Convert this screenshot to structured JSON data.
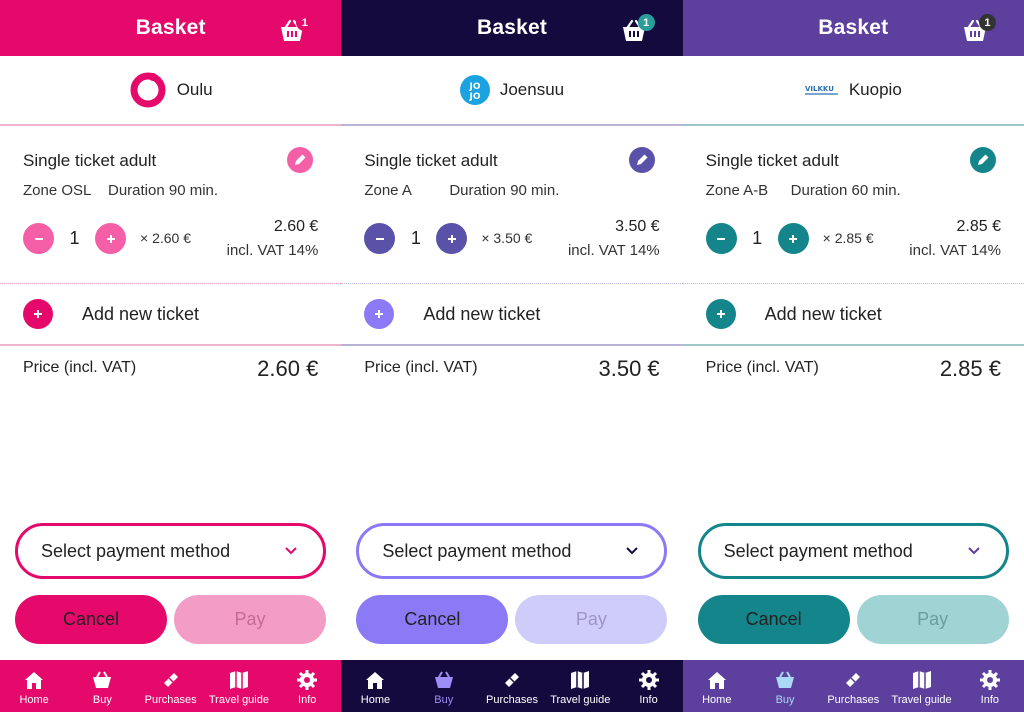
{
  "panels": [
    {
      "city": "Oulu",
      "logo": "oulu-logo",
      "header": {
        "title": "Basket",
        "basket_count": "1"
      },
      "ticket": {
        "name": "Single ticket adult",
        "zone": "Zone OSL",
        "duration": "Duration 90 min.",
        "quantity": "1",
        "unit_price": "× 2.60 €",
        "line_price": "2.60 €",
        "vat": "incl. VAT 14%"
      },
      "add_ticket": "Add new ticket",
      "price_label": "Price  (incl. VAT)",
      "price_value": "2.60 €",
      "payment_select": "Select payment method",
      "cancel": "Cancel",
      "pay": "Pay",
      "tabs": [
        "Home",
        "Buy",
        "Purchases",
        "Travel guide",
        "Info"
      ],
      "colors": {
        "header": "#e5096b",
        "accent": "#f45fa7",
        "add": "#e5096b",
        "cancel_bg": "#e5096b",
        "pay_bg": "#f39dc6",
        "pay_text": "#c46a95",
        "tabbar": "#e5096b",
        "divider": "#f1b4cf",
        "active_tab": "#ffffff",
        "badge": "#e5096b",
        "logo": "#e5096b"
      }
    },
    {
      "city": "Joensuu",
      "logo": "jojo-logo",
      "header": {
        "title": "Basket",
        "basket_count": "1"
      },
      "ticket": {
        "name": "Single ticket adult",
        "zone": "Zone A",
        "duration": "Duration 90 min.",
        "quantity": "1",
        "unit_price": "× 3.50 €",
        "line_price": "3.50 €",
        "vat": "incl. VAT 14%"
      },
      "add_ticket": "Add new ticket",
      "price_label": "Price  (incl. VAT)",
      "price_value": "3.50 €",
      "payment_select": "Select payment method",
      "cancel": "Cancel",
      "pay": "Pay",
      "tabs": [
        "Home",
        "Buy",
        "Purchases",
        "Travel guide",
        "Info"
      ],
      "colors": {
        "header": "#150a3d",
        "accent": "#5a52a8",
        "add": "#8c79f5",
        "cancel_bg": "#8c79f5",
        "pay_bg": "#d0ccfa",
        "pay_text": "#9d96c9",
        "tabbar": "#150a3d",
        "divider": "#b8b4d8",
        "active_tab": "#9e8cf7",
        "badge": "#2a9d9a",
        "logo": "#1aa3e0"
      }
    },
    {
      "city": "Kuopio",
      "logo": "vilkku-logo",
      "header": {
        "title": "Basket",
        "basket_count": "1"
      },
      "ticket": {
        "name": "Single ticket adult",
        "zone": "Zone A-B",
        "duration": "Duration 60 min.",
        "quantity": "1",
        "unit_price": "× 2.85 €",
        "line_price": "2.85 €",
        "vat": "incl. VAT 14%"
      },
      "add_ticket": "Add new ticket",
      "price_label": "Price  (incl. VAT)",
      "price_value": "2.85 €",
      "payment_select": "Select payment method",
      "cancel": "Cancel",
      "pay": "Pay",
      "tabs": [
        "Home",
        "Buy",
        "Purchases",
        "Travel guide",
        "Info"
      ],
      "colors": {
        "header": "#5d3f9e",
        "accent": "#14858a",
        "add": "#14858a",
        "cancel_bg": "#14858a",
        "pay_bg": "#a0d3d4",
        "pay_text": "#6a9ea0",
        "tabbar": "#5d3f9e",
        "divider": "#9cc8ca",
        "active_tab": "#a9d9f5",
        "badge": "#333333",
        "logo": "#2a6fb5"
      }
    }
  ]
}
